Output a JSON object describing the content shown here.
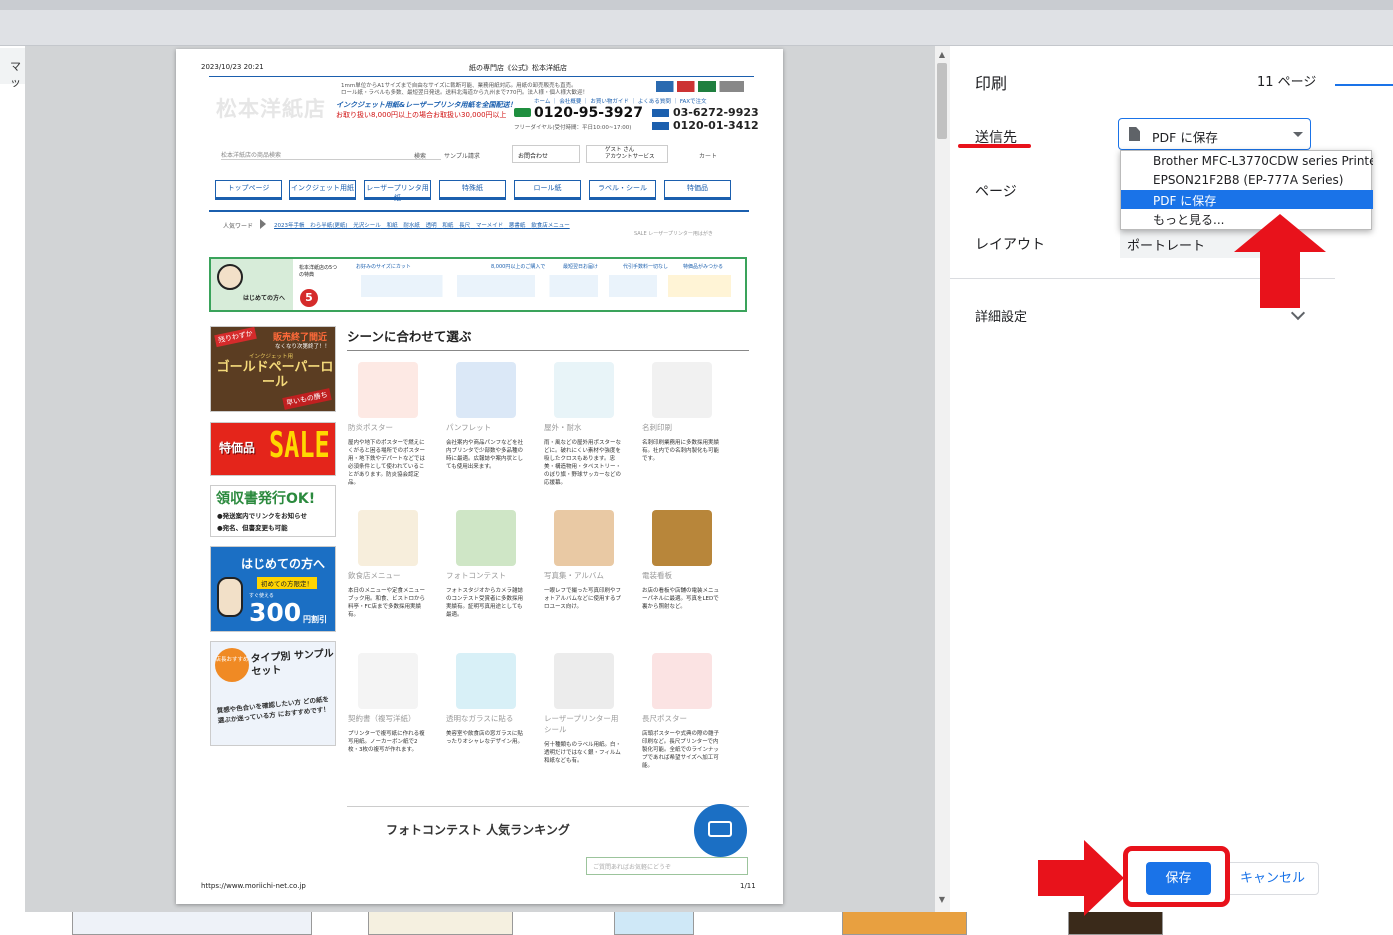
{
  "background": {
    "tab_fragment": "マッ"
  },
  "paper": {
    "timestamp": "2023/10/23 20:21",
    "page_title": "紙の専門店《公式》松本洋紙店",
    "logo_text": "松本洋紙店",
    "tagline_top": "1mm単位からA1サイズまで自由なサイズに裁断可能、業務用紙対応。用紙の卸売販売も直売。",
    "tagline_top2": "ロール紙・ラベルも多数、最短翌日発送。送料北海道から九州まで770円。法人様・個人様大歓迎！",
    "tagline_main": "インクジェット用紙&レーザープリンタ用紙を全国配送！",
    "free_ship": "お取り扱い8,000円以上の場合お取扱い30,000円以上！",
    "header_links": "ホーム ｜ 会社概要 ｜ お買い物ガイド ｜ よくある質問 ｜ FAXで注文",
    "freedial": "0120-95-3927",
    "freedial_note": "フリーダイヤル(受付時間：平日10:00~17:00)",
    "tel": "03-6272-9923",
    "fax": "0120-01-3412",
    "search_placeholder": "松本洋紙店の商品検索",
    "search_btn": "検索",
    "sample_link": "サンプル請求",
    "contact_btn": "お問合わせ",
    "guest_line1": "ゲスト さん",
    "guest_line2": "アカウントサービス",
    "cart": "カート",
    "nav": [
      "トップページ",
      "インクジェット用紙",
      "レーザープリンタ用紙",
      "特殊紙",
      "ロール紙",
      "ラベル・シール",
      "特価品"
    ],
    "keyword_label": "人気ワード",
    "keywords": [
      "2023年手帳",
      "わら半紙(更紙)",
      "光沢シール",
      "和紙",
      "耐水紙",
      "透明",
      "和紙",
      "長尺",
      "マーメイド",
      "悪書紙",
      "飲食店メニュー"
    ],
    "keyword_sub": "SALE レーザープリンター用はがき",
    "perks_title": "松本洋紙店の5つの特典",
    "perks_intro": "はじめての方へ",
    "perks": [
      "お好みのサイズにカット",
      "8,000円以上のご購入で",
      "最短翌日お届け",
      "代引手数料一切なし",
      "特価品がみつかる"
    ],
    "banners": {
      "gold_top": "残りわずか",
      "gold_stop": "販売終了間近",
      "gold_note": "なくなり次第終了！！",
      "gold_title": "ゴールドペーパーロール",
      "gold_sub": "インクジェット用",
      "gold_tag": "早いもの勝ち",
      "sale_label": "特価品",
      "sale_big": "SALE",
      "receipt_title": "領収書発行OK!",
      "receipt_l1": "●発送案内でリンクをお知らせ",
      "receipt_l2": "●宛名、但書変更も可能",
      "first_title": "はじめての方へ",
      "first_sub": "初めての方限定！",
      "first_coupon_note": "すぐ使える",
      "first_amount": "300",
      "first_unit": "円割引",
      "sample_badge": "店長おすすめ",
      "sample_title": "タイプ別 サンプルセット",
      "sample_desc": "質感や色合いを確認したい方 どの紙を選ぶか迷っている方 におすすめです！"
    },
    "scene_heading": "シーンに合わせて選ぶ",
    "scenes": [
      {
        "name": "防炎ポスター",
        "desc": "屋内や地下のポスターで燃えにくがると困る場所でのポスター用・地下鉄やデパートなどでは必須条件として使われていることがあります。防炎協会認定品。"
      },
      {
        "name": "パンフレット",
        "desc": "会社案内や商品パンフなどを社内プリンタで少部数や多品種の時に最適。広報誌や案内状としても使用出来ます。"
      },
      {
        "name": "屋外・耐水",
        "desc": "雨・風などの屋外用ポスターなどに。破れにくい素材や強度を吸したクロスもあります。忠美・構造物用・タペストリー・のぼり旗・野球サッカーなどの応援幕。"
      },
      {
        "name": "名刺印刷",
        "desc": "名刺印刷業務用に多数採用実績有。社内での名刺内製化も可能です。"
      },
      {
        "name": "飲食店メニュー",
        "desc": "本日のメニューや定食メニューブック用。和食、ビストロから料亭・FC店まで多数採用実績有。"
      },
      {
        "name": "フォトコンテスト",
        "desc": "フォトスタジオからカメラ雑誌のコンテスト受賞者に多数採用実績有。証明写真用途としても最適。"
      },
      {
        "name": "写真集・アルバム",
        "desc": "一眼レフで撮った写真印刷やフォトアルバムなどに使用するプロユース向け。"
      },
      {
        "name": "電装看板",
        "desc": "お店の看板や店舗の電装メニューパネルに最適。写真をLEDで裏から照射など。"
      },
      {
        "name": "契約書（複写洋紙）",
        "desc": "プリンターで複写紙に作れる複写用紙。ノーカーボン紙で2枚・3枚の複写が作れます。"
      },
      {
        "name": "透明なガラスに貼る",
        "desc": "美容室や飲食店の窓ガラスに貼ったりオシャレなデザイン用。"
      },
      {
        "name": "レーザープリンター用シール",
        "desc": "何十種類ものラベル用紙。白・透明だけではなく銀・フィルム和紙なども有。"
      },
      {
        "name": "長尺ポスター",
        "desc": "店頭ポスターや式典の際の雛子印刷など。長尺プリンターで内製化可能。全紙でのラインナップであれば希望サイズへ加工可能。"
      }
    ],
    "ranking_heading": "フォトコンテスト 人気ランキング",
    "chat_placeholder": "ご質問あればお気軽にどうぞ",
    "footer_url": "https://www.moriichi-net.co.jp",
    "footer_page": "1/11"
  },
  "print_panel": {
    "title": "印刷",
    "page_count": "11 ページ",
    "destination_label": "送信先",
    "destination_value": "PDF に保存",
    "pages_label": "ページ",
    "layout_label": "レイアウト",
    "layout_value": "ポートレート",
    "more_settings": "詳細設定",
    "dropdown_options": [
      "Brother MFC-L3770CDW series Printer",
      "EPSON21F2B8 (EP-777A Series)",
      "PDF に保存",
      "もっと見る..."
    ],
    "selected_option_index": 2,
    "save_button": "保存",
    "cancel_button": "キャンセル"
  },
  "colors": {
    "accent": "#1a73e8",
    "highlight_red": "#e8121b",
    "brand_blue": "#1b5fae"
  }
}
